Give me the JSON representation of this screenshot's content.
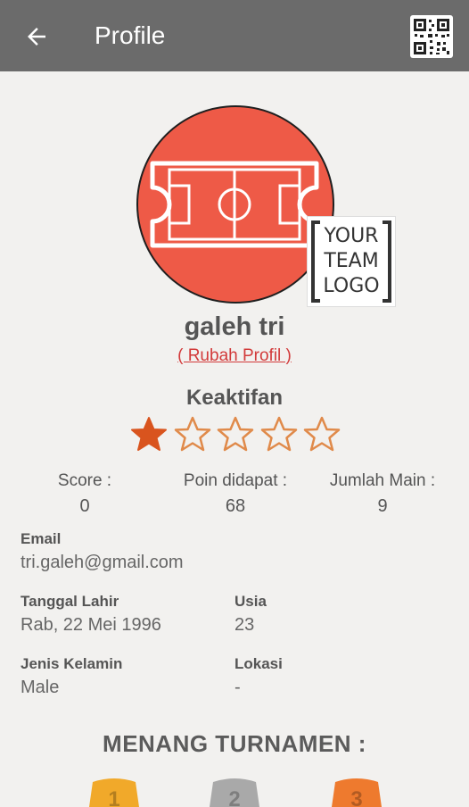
{
  "appbar": {
    "title": "Profile",
    "back_icon": "arrow-left-icon",
    "qr_icon": "qr-code-icon"
  },
  "profile": {
    "name": "galeh tri",
    "edit_label": "( Rubah Profil )",
    "team_logo_lines": [
      "YOUR",
      "TEAM",
      "LOGO"
    ]
  },
  "activity": {
    "title": "Keaktifan",
    "rating": 1,
    "max_rating": 5,
    "colors": {
      "filled": "#d9541e",
      "outline": "#e08a4a"
    }
  },
  "stats": [
    {
      "label": "Score :",
      "value": "0"
    },
    {
      "label": "Poin didapat :",
      "value": "68"
    },
    {
      "label": "Jumlah Main :",
      "value": "9"
    }
  ],
  "info": {
    "email_label": "Email",
    "email_value": "tri.galeh@gmail.com",
    "birth_label": "Tanggal Lahir",
    "birth_value": "Rab, 22 Mei 1996",
    "age_label": "Usia",
    "age_value": "23",
    "gender_label": "Jenis Kelamin",
    "gender_value": "Male",
    "location_label": "Lokasi",
    "location_value": "-"
  },
  "tournament": {
    "title": "MENANG TURNAMEN :",
    "medals": [
      {
        "rank": "1",
        "color": "#f1a92a"
      },
      {
        "rank": "2",
        "color": "#a9a9a9"
      },
      {
        "rank": "3",
        "color": "#ee7a2e"
      }
    ]
  },
  "colors": {
    "appbar": "#6b6b6b",
    "avatar": "#ee5a47",
    "link": "#d23a3a"
  }
}
